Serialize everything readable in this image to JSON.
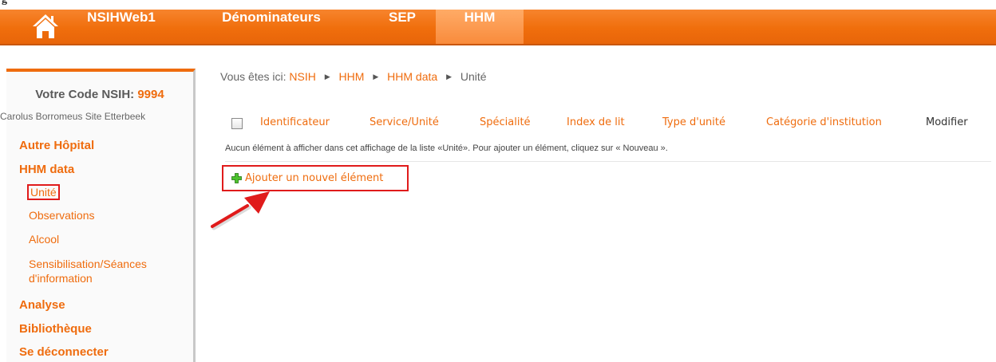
{
  "fragment_top": "g",
  "nav": {
    "items": [
      {
        "label": "NSIHWeb1"
      },
      {
        "label": "Dénominateurs"
      },
      {
        "label": "SEP"
      },
      {
        "label": "HHM"
      }
    ],
    "active": "HHM"
  },
  "sidebar": {
    "code_label": "Votre Code NSIH:",
    "code_value": "9994",
    "site_name": "Carolus Borromeus Site Etterbeek",
    "menu": [
      {
        "label": "Autre Hôpital",
        "level": 1
      },
      {
        "label": "HHM data",
        "level": 1
      },
      {
        "label": "Unité",
        "level": 2,
        "current": true
      },
      {
        "label": "Observations",
        "level": 2
      },
      {
        "label": "Alcool",
        "level": 2
      },
      {
        "label": "Sensibilisation/Séances d'information",
        "level": 2
      },
      {
        "label": "Analyse",
        "level": 1
      },
      {
        "label": "Bibliothèque",
        "level": 1
      },
      {
        "label": "Se déconnecter",
        "level": 1
      }
    ]
  },
  "breadcrumb": {
    "prefix": "Vous êtes ici:",
    "items": [
      "NSIH",
      "HHM",
      "HHM data",
      "Unité"
    ]
  },
  "list": {
    "columns": [
      "Identificateur",
      "Service/Unité",
      "Spécialité",
      "Index de lit",
      "Type d'unité",
      "Catégorie d'institution",
      "Modifier"
    ],
    "empty_message": "Aucun élément à afficher dans cet affichage de la liste «Unité». Pour ajouter un élément, cliquez sur « Nouveau ».",
    "add_new_label": "Ajouter un nouvel élément"
  },
  "colors": {
    "brand_orange": "#ef6c0e",
    "highlight_red": "#e01b1b"
  },
  "icons": [
    "home-icon",
    "plus-icon",
    "arrow-annotation"
  ]
}
